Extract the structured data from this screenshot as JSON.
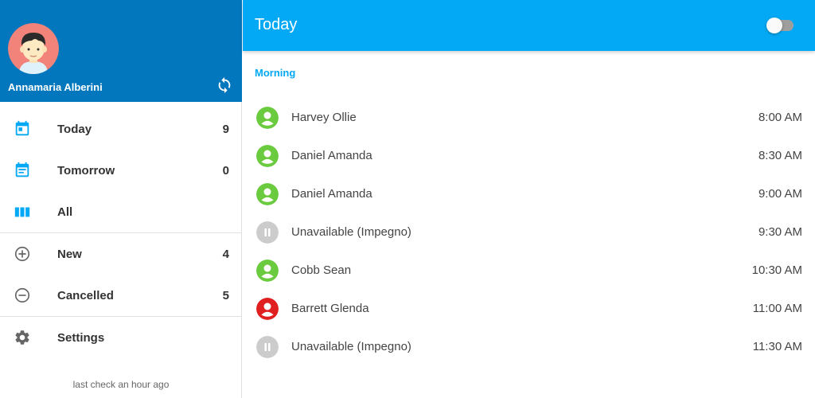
{
  "user": {
    "name": "Annamaria Alberini"
  },
  "icons": {
    "refresh": "refresh-icon",
    "avatar": "avatar-illustration"
  },
  "nav": {
    "today": {
      "label": "Today",
      "count": "9",
      "icon": "calendar-today-icon"
    },
    "tomorrow": {
      "label": "Tomorrow",
      "count": "0",
      "icon": "calendar-icon"
    },
    "all": {
      "label": "All",
      "icon": "view-columns-icon"
    },
    "new": {
      "label": "New",
      "count": "4",
      "icon": "plus-circle-icon"
    },
    "cancelled": {
      "label": "Cancelled",
      "count": "5",
      "icon": "minus-circle-icon"
    },
    "settings": {
      "label": "Settings",
      "icon": "gear-icon"
    }
  },
  "footer": {
    "last_check": "last check an hour ago"
  },
  "topbar": {
    "title": "Today",
    "toggle_on": false
  },
  "section": {
    "title": "Morning"
  },
  "colors": {
    "sidebar_header": "#0277bd",
    "topbar": "#03a9f4",
    "confirmed": "#6bcb3f",
    "cancelled": "#e02020",
    "unavailable": "#cccccc"
  },
  "appointments": [
    {
      "name": "Harvey Ollie",
      "time": "8:00 AM",
      "status": "confirmed"
    },
    {
      "name": "Daniel Amanda",
      "time": "8:30 AM",
      "status": "confirmed"
    },
    {
      "name": "Daniel Amanda",
      "time": "9:00 AM",
      "status": "confirmed"
    },
    {
      "name": "Unavailable (Impegno)",
      "time": "9:30 AM",
      "status": "unavailable"
    },
    {
      "name": "Cobb Sean",
      "time": "10:30 AM",
      "status": "confirmed"
    },
    {
      "name": "Barrett Glenda",
      "time": "11:00 AM",
      "status": "cancelled"
    },
    {
      "name": "Unavailable (Impegno)",
      "time": "11:30 AM",
      "status": "unavailable"
    }
  ]
}
